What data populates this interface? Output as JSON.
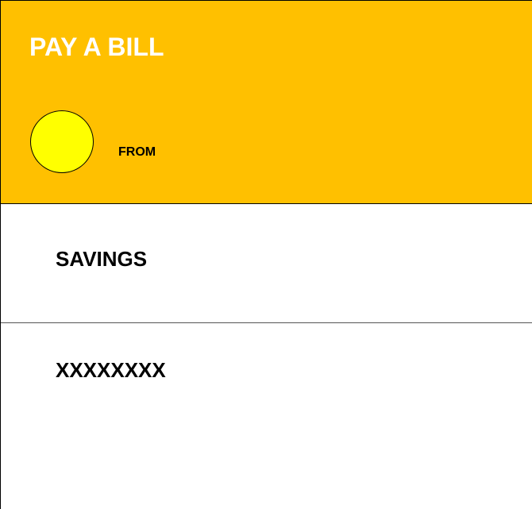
{
  "header": {
    "title": "PAY A BILL",
    "from_label": "FROM",
    "background_color": "#ffc000",
    "avatar_color": "#ffff00"
  },
  "accounts": [
    {
      "label": "SAVINGS"
    },
    {
      "label": "XXXXXXXX"
    }
  ]
}
